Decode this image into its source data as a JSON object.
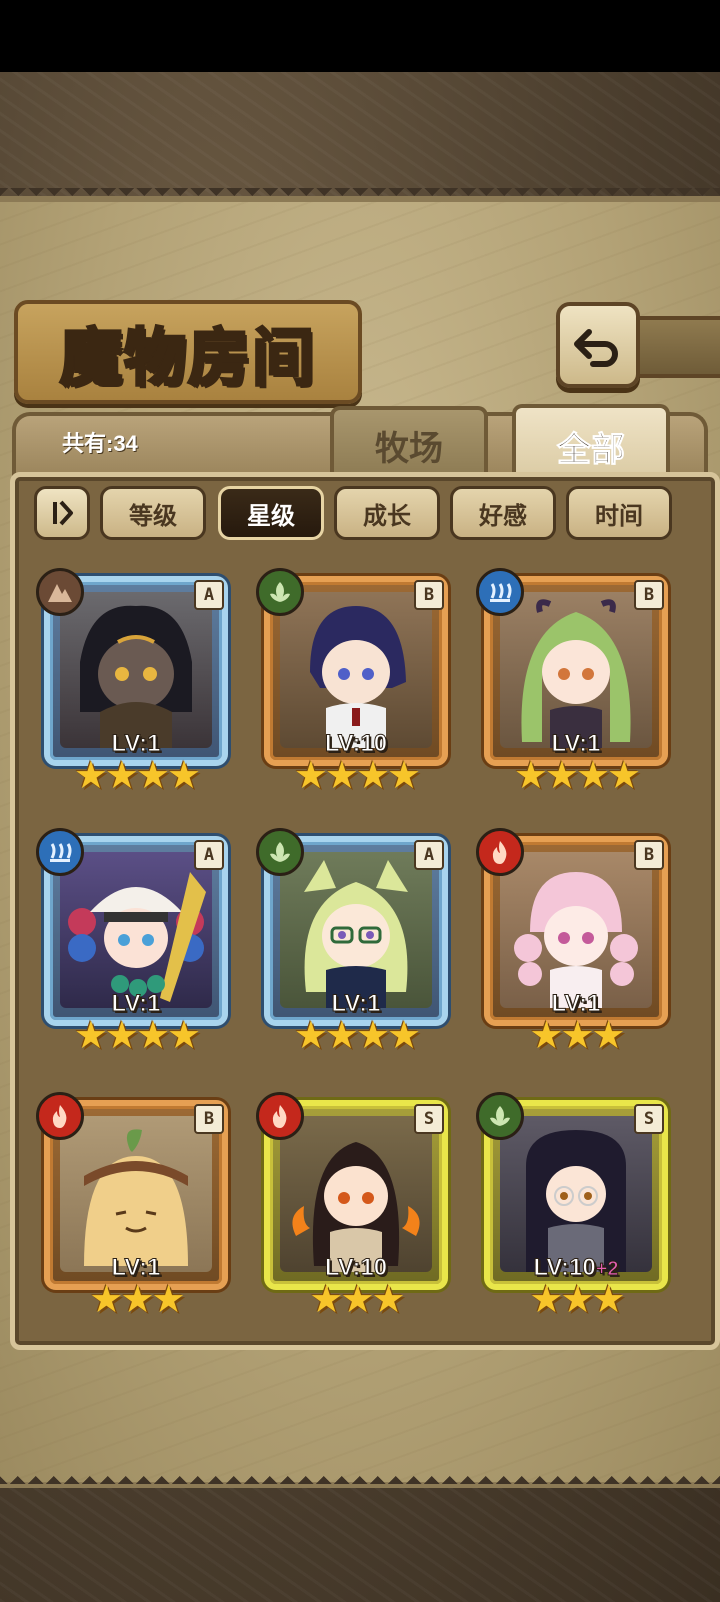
{
  "header": {
    "title": "魔物房间"
  },
  "collection": {
    "count_label": "共有:34"
  },
  "tabs": [
    {
      "label": "牧场",
      "active": false
    },
    {
      "label": "全部",
      "active": true
    }
  ],
  "sort": {
    "options": [
      "等级",
      "星级",
      "成长",
      "好感",
      "时间"
    ],
    "active": "星级"
  },
  "monsters": [
    {
      "rank": "A",
      "element": "earth-icon",
      "level": "LV:1",
      "bonus": "",
      "stars": 4,
      "frame": "blue"
    },
    {
      "rank": "B",
      "element": "leaf-icon",
      "level": "LV:10",
      "bonus": "",
      "stars": 4,
      "frame": "orange"
    },
    {
      "rank": "B",
      "element": "water-icon",
      "level": "LV:1",
      "bonus": "",
      "stars": 4,
      "frame": "orange"
    },
    {
      "rank": "A",
      "element": "water-icon",
      "level": "LV:1",
      "bonus": "",
      "stars": 4,
      "frame": "blue"
    },
    {
      "rank": "A",
      "element": "leaf-icon",
      "level": "LV:1",
      "bonus": "",
      "stars": 4,
      "frame": "blue"
    },
    {
      "rank": "B",
      "element": "fire-icon",
      "level": "LV:1",
      "bonus": "",
      "stars": 3,
      "frame": "orange"
    },
    {
      "rank": "B",
      "element": "fire-icon",
      "level": "LV:1",
      "bonus": "",
      "stars": 3,
      "frame": "orange"
    },
    {
      "rank": "S",
      "element": "fire-icon",
      "level": "LV:10",
      "bonus": "",
      "stars": 3,
      "frame": "yellow"
    },
    {
      "rank": "S",
      "element": "leaf-icon",
      "level": "LV:10",
      "bonus": "+2",
      "stars": 3,
      "frame": "yellow"
    }
  ],
  "colors": {
    "frame_blue": "#a8d4ee",
    "frame_orange": "#e6a053",
    "frame_yellow": "#e9e64a",
    "star": "#f7c52a",
    "element_fire": "#c4281c",
    "element_water": "#2d6fb8",
    "element_wood": "#3f6b2a",
    "element_earth": "#6b4a35"
  }
}
